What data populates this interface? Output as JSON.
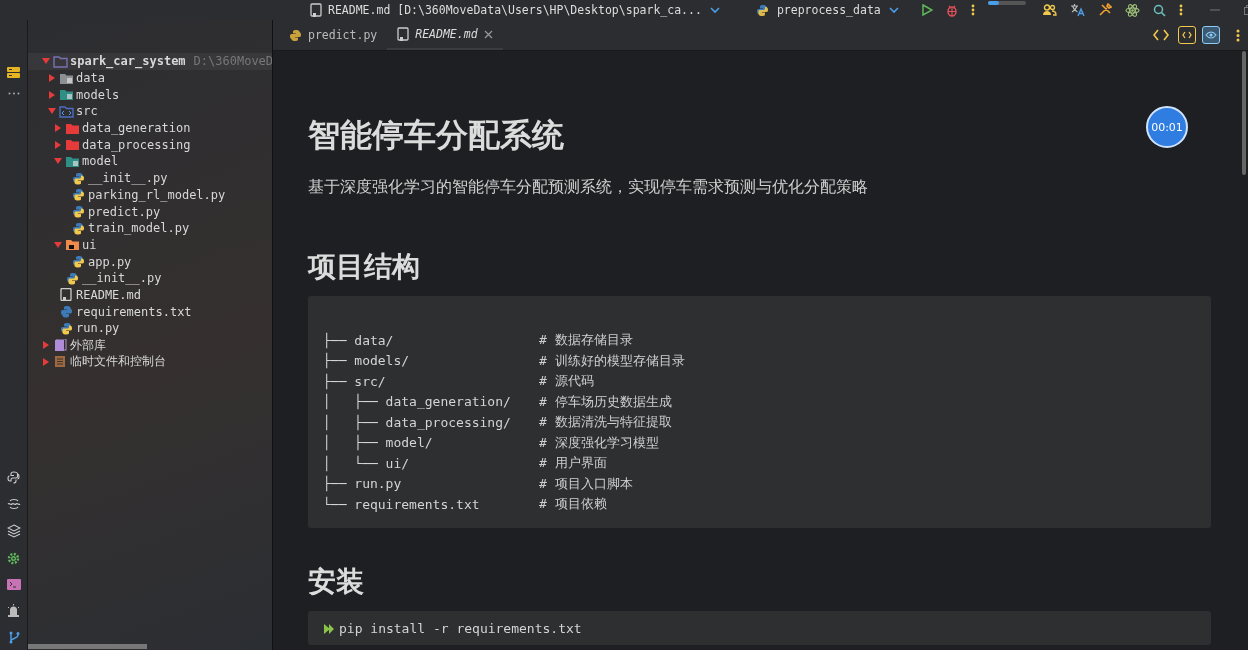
{
  "title_bar": {
    "file": "README.md [D:\\360MoveData\\Users\\HP\\Desktop\\spark_ca...",
    "run_config": "preprocess_data",
    "progress": {
      "level": 0.3
    }
  },
  "project_tree": [
    {
      "label": "spark_car_system",
      "path": "D:\\360MoveD",
      "kind": "project",
      "expanded": true,
      "children": [
        {
          "label": "data",
          "kind": "folder",
          "expanded": false
        },
        {
          "label": "models",
          "kind": "package",
          "expanded": false
        },
        {
          "label": "src",
          "kind": "source",
          "expanded": true,
          "children": [
            {
              "label": "data_generation",
              "kind": "marked",
              "expanded": false
            },
            {
              "label": "data_processing",
              "kind": "marked",
              "expanded": false
            },
            {
              "label": "model",
              "kind": "package",
              "expanded": true,
              "children": [
                {
                  "label": "__init__.py",
                  "kind": "python"
                },
                {
                  "label": "parking_rl_model.py",
                  "kind": "python"
                },
                {
                  "label": "predict.py",
                  "kind": "python"
                },
                {
                  "label": "train_model.py",
                  "kind": "python"
                }
              ]
            },
            {
              "label": "ui",
              "kind": "module",
              "expanded": true,
              "children": [
                {
                  "label": "app.py",
                  "kind": "python"
                }
              ]
            },
            {
              "label": "__init__.py",
              "kind": "python"
            }
          ]
        },
        {
          "label": "README.md",
          "kind": "markdown"
        },
        {
          "label": "requirements.txt",
          "kind": "text"
        },
        {
          "label": "run.py",
          "kind": "python"
        }
      ]
    },
    {
      "label": "外部库",
      "kind": "library",
      "expanded": false
    },
    {
      "label": "临时文件和控制台",
      "kind": "scratch",
      "expanded": false
    }
  ],
  "tabs": [
    {
      "label": "predict.py",
      "kind": "python",
      "selected": false
    },
    {
      "label": "README.md",
      "kind": "markdown",
      "selected": true
    }
  ],
  "document": {
    "title": "智能停车分配系统",
    "intro": "基于深度强化学习的智能停车分配预测系统，实现停车需求预测与优化分配策略",
    "sections": [
      {
        "heading": "项目结构",
        "code": [
          {
            "path": "├── data/",
            "comment": "# 数据存储目录"
          },
          {
            "path": "├── models/",
            "comment": "# 训练好的模型存储目录"
          },
          {
            "path": "├── src/",
            "comment": "# 源代码"
          },
          {
            "path": "│   ├── data_generation/",
            "comment": "# 停车场历史数据生成"
          },
          {
            "path": "│   ├── data_processing/",
            "comment": "# 数据清洗与特征提取"
          },
          {
            "path": "│   ├── model/",
            "comment": "# 深度强化学习模型"
          },
          {
            "path": "│   └── ui/",
            "comment": "# 用户界面"
          },
          {
            "path": "├── run.py",
            "comment": "# 项目入口脚本"
          },
          {
            "path": "└── requirements.txt",
            "comment": "# 项目依赖"
          }
        ]
      },
      {
        "heading": "安装",
        "code": [
          {
            "path": "pip install -r requirements.txt",
            "runnable": true
          }
        ]
      }
    ]
  },
  "recording_timer": "00:01"
}
